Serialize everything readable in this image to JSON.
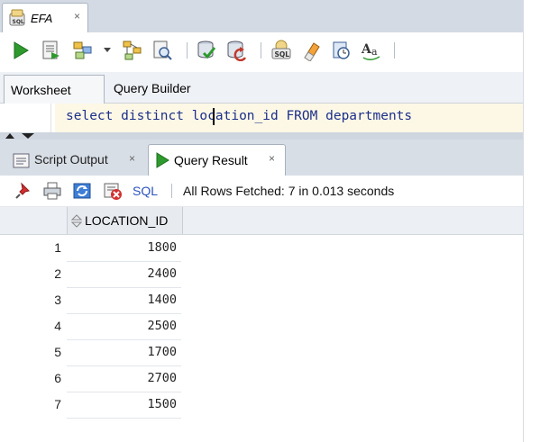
{
  "document_tab": {
    "title": "EFA",
    "close_glyph": "×",
    "icon": "sql-worksheet-icon"
  },
  "toolbar": {
    "buttons": [
      {
        "name": "run-statement-button",
        "icon": "play-icon"
      },
      {
        "name": "run-script-button",
        "icon": "script-icon"
      },
      {
        "name": "autotrace-button",
        "icon": "autotrace-icon"
      },
      {
        "name": "explain-plan-button",
        "icon": "explain-plan-icon"
      },
      {
        "name": "sql-tuning-advisor-button",
        "icon": "tuning-icon"
      },
      {
        "name": "commit-button",
        "icon": "commit-icon"
      },
      {
        "name": "rollback-button",
        "icon": "rollback-icon"
      },
      {
        "name": "unshared-sql-worksheet-button",
        "icon": "sql-worksheet-icon"
      },
      {
        "name": "clear-button",
        "icon": "eraser-icon"
      },
      {
        "name": "sql-history-button",
        "icon": "history-icon"
      },
      {
        "name": "to-upper-lower-button",
        "icon": "text-case-icon"
      }
    ]
  },
  "sub_tabs": {
    "worksheet": "Worksheet",
    "query_builder": "Query Builder"
  },
  "editor": {
    "code_parts": [
      "select distinct ",
      "location_id ",
      "FROM",
      " departments"
    ]
  },
  "output_tabs": {
    "script_output": "Script Output",
    "query_result": "Query Result",
    "close_glyph": "×"
  },
  "result_toolbar": {
    "sql_link": "SQL",
    "status": "All Rows Fetched: 7 in 0.013 seconds"
  },
  "grid": {
    "column_header": "LOCATION_ID",
    "rows": [
      {
        "num": "1",
        "value": "1800"
      },
      {
        "num": "2",
        "value": "2400"
      },
      {
        "num": "3",
        "value": "1400"
      },
      {
        "num": "4",
        "value": "2500"
      },
      {
        "num": "5",
        "value": "1700"
      },
      {
        "num": "6",
        "value": "2700"
      },
      {
        "num": "7",
        "value": "1500"
      }
    ]
  },
  "colors": {
    "accent_green": "#2e9a2e",
    "link_blue": "#2a52be",
    "editor_line": "#fdf8e6"
  }
}
